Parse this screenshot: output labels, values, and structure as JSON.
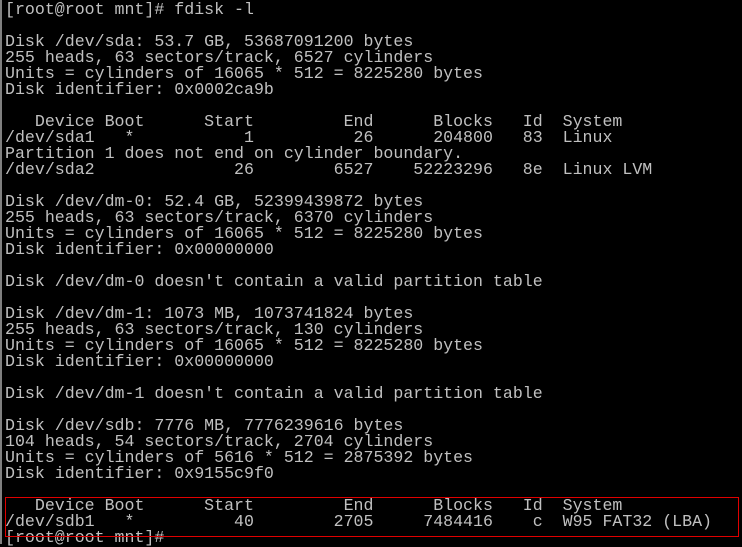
{
  "terminal": {
    "lines": [
      "[root@root mnt]# fdisk -l",
      "",
      "Disk /dev/sda: 53.7 GB, 53687091200 bytes",
      "255 heads, 63 sectors/track, 6527 cylinders",
      "Units = cylinders of 16065 * 512 = 8225280 bytes",
      "Disk identifier: 0x0002ca9b",
      "",
      "   Device Boot      Start         End      Blocks   Id  System",
      "/dev/sda1   *           1          26      204800   83  Linux",
      "Partition 1 does not end on cylinder boundary.",
      "/dev/sda2              26        6527    52223296   8e  Linux LVM",
      "",
      "Disk /dev/dm-0: 52.4 GB, 52399439872 bytes",
      "255 heads, 63 sectors/track, 6370 cylinders",
      "Units = cylinders of 16065 * 512 = 8225280 bytes",
      "Disk identifier: 0x00000000",
      "",
      "Disk /dev/dm-0 doesn't contain a valid partition table",
      "",
      "Disk /dev/dm-1: 1073 MB, 1073741824 bytes",
      "255 heads, 63 sectors/track, 130 cylinders",
      "Units = cylinders of 16065 * 512 = 8225280 bytes",
      "Disk identifier: 0x00000000",
      "",
      "Disk /dev/dm-1 doesn't contain a valid partition table",
      "",
      "Disk /dev/sdb: 7776 MB, 7776239616 bytes",
      "104 heads, 54 sectors/track, 2704 cylinders",
      "Units = cylinders of 5616 * 512 = 2875392 bytes",
      "Disk identifier: 0x9155c9f0",
      "",
      "   Device Boot      Start         End      Blocks   Id  System",
      "/dev/sdb1   *          40        2705     7484416    c  W95 FAT32 (LBA)",
      "[root@root mnt]# "
    ]
  },
  "colors": {
    "background": "#000000",
    "text": "#c0c0c0",
    "highlight": "#e00000"
  }
}
